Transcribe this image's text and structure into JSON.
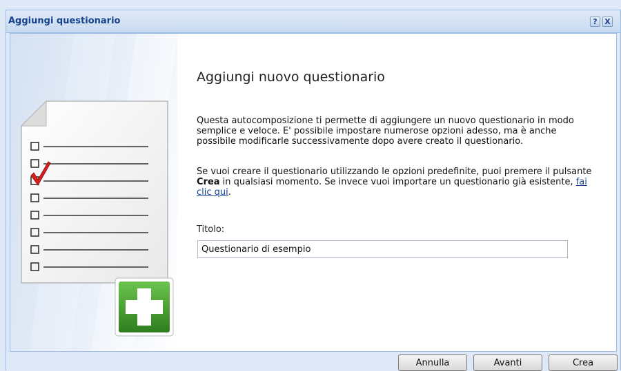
{
  "window": {
    "title": "Aggiungi questionario",
    "help_glyph": "?",
    "close_glyph": "X"
  },
  "main": {
    "heading": "Aggiungi nuovo questionario",
    "paragraph1": "Questa autocomposizione ti permette di aggiungere un nuovo questionario in modo semplice e veloce. E' possibile impostare numerose opzioni adesso, ma è anche possibile modificarle successivamente dopo avere creato il questionario.",
    "paragraph2_prefix": "Se vuoi creare il questionario utilizzando le opzioni predefinite, puoi premere il pulsante ",
    "paragraph2_bold": "Crea",
    "paragraph2_middle": " in qualsiasi momento. Se invece vuoi importare un questionario già esistente, ",
    "paragraph2_link": "fai clic qui",
    "paragraph2_suffix": ".",
    "title_label": "Titolo:",
    "title_value": "Questionario di esempio"
  },
  "footer": {
    "cancel_label": "Annulla",
    "next_label": "Avanti",
    "create_label": "Crea"
  },
  "illustration": {
    "icon": "questionnaire-document-icon",
    "badge_icon": "plus-badge-icon",
    "colors": {
      "badge_green": "#3e9a2c",
      "check_red": "#d42020"
    }
  }
}
